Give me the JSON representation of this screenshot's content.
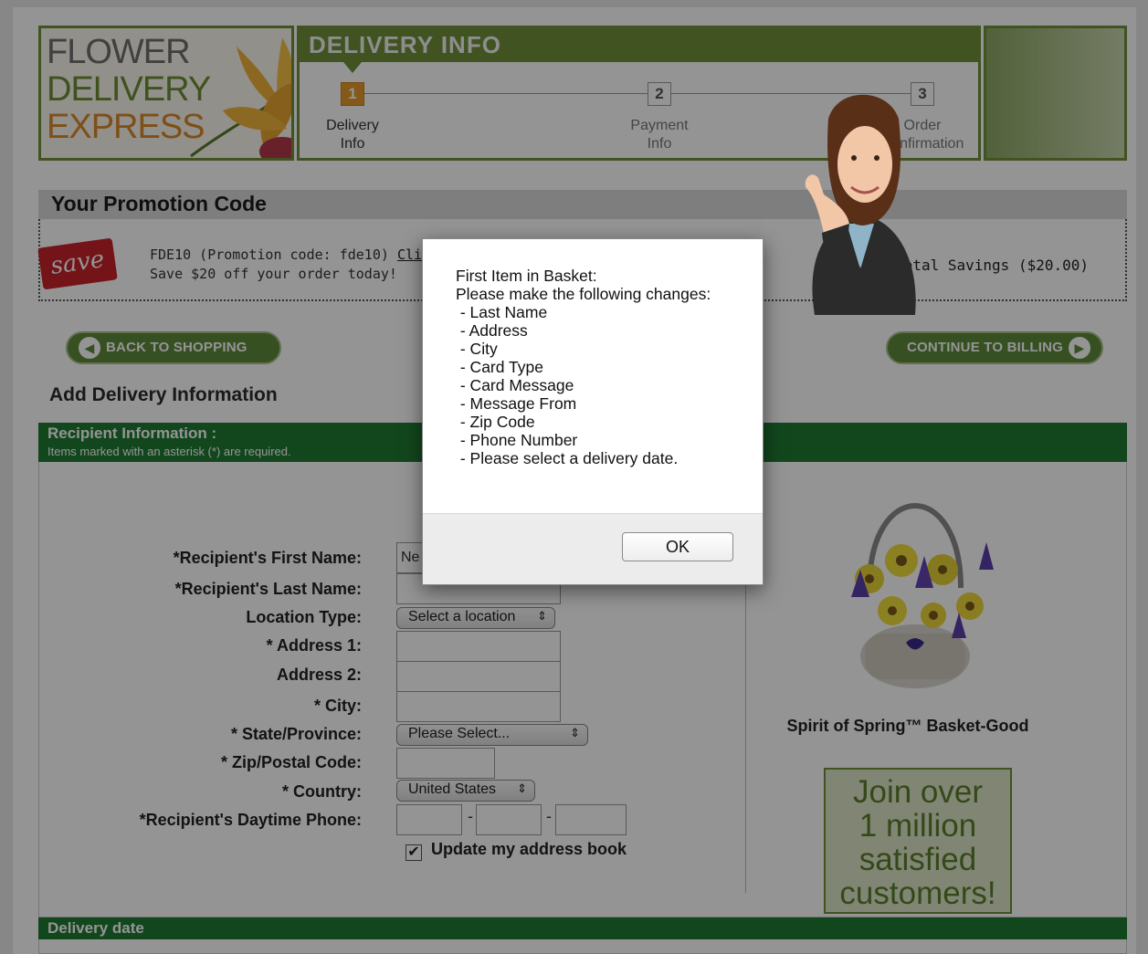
{
  "logo": {
    "lines": [
      "FLOWER",
      "DELIVERY",
      "EXPRESS"
    ]
  },
  "steps": {
    "title": "DELIVERY INFO",
    "items": [
      {
        "num": "1",
        "label_1": "Delivery",
        "label_2": "Info",
        "active": true
      },
      {
        "num": "2",
        "label_1": "Payment",
        "label_2": "Info",
        "active": false
      },
      {
        "num": "3",
        "label_1": "Order",
        "label_2": "Confirmation",
        "active": false
      }
    ]
  },
  "promo": {
    "heading": "Your Promotion Code",
    "save_tag": "save",
    "line1_text": "FDE10  (Promotion code: fde10) ",
    "line1_link": "Click",
    "line2": "Save $20 off your order today!",
    "total_savings": "Total Savings ($20.00)"
  },
  "nav": {
    "back_label": "BACK TO SHOPPING CART",
    "continue_label": "CONTINUE TO BILLING"
  },
  "form": {
    "section_title": "Add Delivery Information",
    "recipient_header": "Recipient Information :",
    "required_note": "Items marked with an asterisk (*) are required.",
    "labels": {
      "first_name": "*Recipient's First Name:",
      "last_name": "*Recipient's Last Name:",
      "location_type": "Location Type:",
      "address1": "* Address 1:",
      "address2": "Address 2:",
      "city": "* City:",
      "state": "* State/Province:",
      "zip": "* Zip/Postal Code:",
      "country": "* Country:",
      "phone": "*Recipient's Daytime Phone:"
    },
    "values": {
      "first_name": "Ne",
      "last_name": "",
      "location_type": "Select a location",
      "address1": "",
      "address2": "",
      "city": "",
      "state": "Please Select...",
      "zip": "",
      "country": "United States",
      "phone_1": "",
      "phone_2": "",
      "phone_3": ""
    },
    "phone_separator": "-",
    "update_address_book": "Update my address book",
    "delivery_date_header": "Delivery date"
  },
  "product": {
    "name": "Spirit of Spring™ Basket-Good"
  },
  "join_box": {
    "lines": [
      "Join over",
      "1 million",
      "satisfied",
      "customers!"
    ]
  },
  "dialog": {
    "message": "First Item in Basket:\nPlease make the following changes:\n - Last Name\n - Address\n - City\n - Card Type\n - Card Message\n - Message From\n - Zip Code\n - Phone Number\n - Please select a delivery date.",
    "ok_label": "OK"
  },
  "colors": {
    "brand_green": "#6f8f3a",
    "section_green": "#1f7a33",
    "save_red": "#c8232b",
    "step_active": "#e49a2c"
  }
}
